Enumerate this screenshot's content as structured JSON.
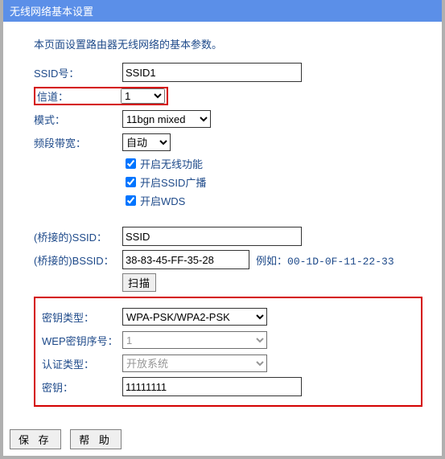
{
  "title": "无线网络基本设置",
  "intro": "本页面设置路由器无线网络的基本参数。",
  "labels": {
    "ssid": "SSID号：",
    "channel": "信道：",
    "mode": "模式：",
    "bandwidth": "频段带宽：",
    "enable_wireless": "开启无线功能",
    "enable_ssid_broadcast": "开启SSID广播",
    "enable_wds": "开启WDS",
    "bridge_ssid": "(桥接的)SSID：",
    "bridge_bssid": "(桥接的)BSSID：",
    "bssid_hint_prefix": "例如：",
    "bssid_hint_value": "00-1D-0F-11-22-33",
    "scan": "扫描",
    "key_type": "密钥类型：",
    "wep_index": "WEP密钥序号：",
    "auth_type": "认证类型：",
    "key": "密钥：",
    "save": "保 存",
    "help": "帮 助"
  },
  "values": {
    "ssid": "SSID1",
    "channel": "1",
    "mode": "11bgn mixed",
    "bandwidth": "自动",
    "enable_wireless": true,
    "enable_ssid_broadcast": true,
    "enable_wds": true,
    "bridge_ssid": "SSID",
    "bridge_bssid": "38-83-45-FF-35-28",
    "key_type": "WPA-PSK/WPA2-PSK",
    "wep_index": "1",
    "auth_type": "开放系统",
    "key": "11111111"
  }
}
